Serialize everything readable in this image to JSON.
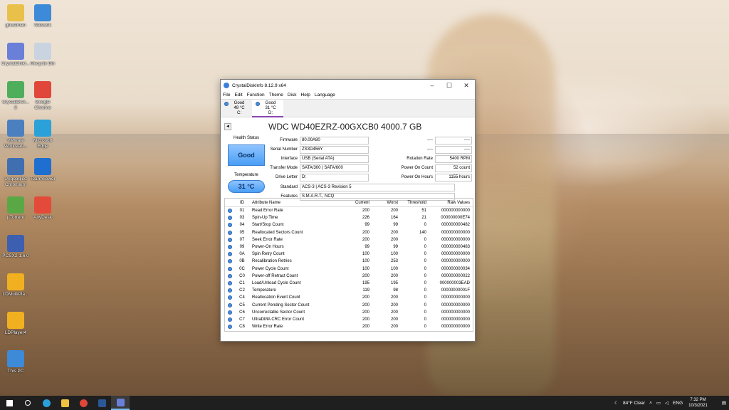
{
  "desktop": {
    "icons": [
      {
        "label": "ghostman",
        "color": "#e8c04a"
      },
      {
        "label": "Network",
        "color": "#3d8ad8"
      },
      {
        "label": "CrystalDiskI...",
        "color": "#6a7fd8"
      },
      {
        "label": "Recycle Bin",
        "color": "#c9d4e0"
      },
      {
        "label": "CrystalDisk...\n8",
        "color": "#4fae5b"
      },
      {
        "label": "Google\nChrome",
        "color": "#e0463a"
      },
      {
        "label": "VMware\nWorkstati...",
        "color": "#4a7fc0"
      },
      {
        "label": "Microsoft\nEdge",
        "color": "#2aa1d8"
      },
      {
        "label": "Ungoogled\nChromium",
        "color": "#3f6fb0"
      },
      {
        "label": "TeamViewer",
        "color": "#1e6fd0"
      },
      {
        "label": "µTorrent",
        "color": "#5aa845"
      },
      {
        "label": "AnyDesk",
        "color": "#e34a3a"
      },
      {
        "label": "PCSX2 1.6.0",
        "color": "#3c5fb0"
      },
      {
        "label": "LDMultiPla...",
        "color": "#f0b020"
      },
      {
        "label": "LDPlayer4",
        "color": "#f0b020"
      },
      {
        "label": "This PC",
        "color": "#3c8ad8"
      }
    ]
  },
  "window": {
    "title": "CrystalDiskInfo 8.12.9 x64",
    "controls": {
      "minimize": "–",
      "maximize": "☐",
      "close": "✕"
    },
    "menu": [
      "File",
      "Edit",
      "Function",
      "Theme",
      "Disk",
      "Help",
      "Language"
    ],
    "drives": [
      {
        "status": "Good",
        "temp": "49 °C",
        "letter": "C:"
      },
      {
        "status": "Good",
        "temp": "31 °C",
        "letter": "D:"
      }
    ],
    "nav_prev": "◄",
    "model": "WDC WD40EZRZ-00GXCB0 4000.7 GB",
    "health_status_label": "Health Status",
    "health_status": "Good",
    "temperature_label": "Temperature",
    "temperature": "31 °C",
    "info": {
      "firmware": {
        "k": "Firmware",
        "v": "80.00A80"
      },
      "serial": {
        "k": "Serial Number",
        "v": "ZS3D456Y"
      },
      "interface": {
        "k": "Interface",
        "v": "USB (Serial ATA)"
      },
      "transfer": {
        "k": "Transfer Mode",
        "v": "SATA/300 | SATA/600"
      },
      "letter": {
        "k": "Drive Letter",
        "v": "D:"
      },
      "standard": {
        "k": "Standard",
        "v": "ACS-3 | ACS-3 Revision 5"
      },
      "features": {
        "k": "Features",
        "v": "S.M.A.R.T., NCQ"
      },
      "dash1": {
        "k": "----",
        "v": "----"
      },
      "dash2": {
        "k": "----",
        "v": "----"
      },
      "rotation": {
        "k": "Rotation Rate",
        "v": "5400 RPM"
      },
      "poweron_count": {
        "k": "Power On Count",
        "v": "52 count"
      },
      "poweron_hours": {
        "k": "Power On Hours",
        "v": "1155 hours"
      }
    },
    "table": {
      "headers": {
        "id": "ID",
        "name": "Attribute Name",
        "current": "Current",
        "worst": "Worst",
        "threshold": "Threshold",
        "raw": "Raw Values"
      },
      "rows": [
        {
          "id": "01",
          "name": "Read Error Rate",
          "current": "200",
          "worst": "200",
          "threshold": "51",
          "raw": "000000000000"
        },
        {
          "id": "03",
          "name": "Spin-Up Time",
          "current": "226",
          "worst": "164",
          "threshold": "21",
          "raw": "000000000E74"
        },
        {
          "id": "04",
          "name": "Start/Stop Count",
          "current": "99",
          "worst": "99",
          "threshold": "0",
          "raw": "000000000482"
        },
        {
          "id": "05",
          "name": "Reallocated Sectors Count",
          "current": "200",
          "worst": "200",
          "threshold": "140",
          "raw": "000000000000"
        },
        {
          "id": "07",
          "name": "Seek Error Rate",
          "current": "200",
          "worst": "200",
          "threshold": "0",
          "raw": "000000000000"
        },
        {
          "id": "09",
          "name": "Power-On Hours",
          "current": "99",
          "worst": "99",
          "threshold": "0",
          "raw": "000000000483"
        },
        {
          "id": "0A",
          "name": "Spin Retry Count",
          "current": "100",
          "worst": "100",
          "threshold": "0",
          "raw": "000000000000"
        },
        {
          "id": "0B",
          "name": "Recalibration Retries",
          "current": "100",
          "worst": "253",
          "threshold": "0",
          "raw": "000000000000"
        },
        {
          "id": "0C",
          "name": "Power Cycle Count",
          "current": "100",
          "worst": "100",
          "threshold": "0",
          "raw": "000000000034"
        },
        {
          "id": "C0",
          "name": "Power-off Retract Count",
          "current": "200",
          "worst": "200",
          "threshold": "0",
          "raw": "000000000022"
        },
        {
          "id": "C1",
          "name": "Load/Unload Cycle Count",
          "current": "195",
          "worst": "195",
          "threshold": "0",
          "raw": "000000003EAD"
        },
        {
          "id": "C2",
          "name": "Temperature",
          "current": "119",
          "worst": "98",
          "threshold": "0",
          "raw": "00000000001F"
        },
        {
          "id": "C4",
          "name": "Reallocation Event Count",
          "current": "200",
          "worst": "200",
          "threshold": "0",
          "raw": "000000000000"
        },
        {
          "id": "C5",
          "name": "Current Pending Sector Count",
          "current": "200",
          "worst": "200",
          "threshold": "0",
          "raw": "000000000000"
        },
        {
          "id": "C6",
          "name": "Uncorrectable Sector Count",
          "current": "200",
          "worst": "200",
          "threshold": "0",
          "raw": "000000000000"
        },
        {
          "id": "C7",
          "name": "UltraDMA CRC Error Count",
          "current": "200",
          "worst": "200",
          "threshold": "0",
          "raw": "000000000000"
        },
        {
          "id": "C8",
          "name": "Write Error Rate",
          "current": "200",
          "worst": "200",
          "threshold": "0",
          "raw": "000000000000"
        }
      ]
    }
  },
  "taskbar": {
    "apps": [
      {
        "name": "start",
        "color": "#ffffff"
      },
      {
        "name": "search",
        "color": "#ffffff"
      },
      {
        "name": "edge",
        "color": "#2aa1d8"
      },
      {
        "name": "explorer",
        "color": "#f0c040"
      },
      {
        "name": "chrome",
        "color": "#e0463a"
      },
      {
        "name": "powershell",
        "color": "#2b5797"
      },
      {
        "name": "crystaldiskinfo",
        "color": "#6a7fd8"
      }
    ],
    "weather": "84°F  Clear",
    "lang": "ENG",
    "time": "7:32 PM",
    "date": "10/3/2021"
  }
}
